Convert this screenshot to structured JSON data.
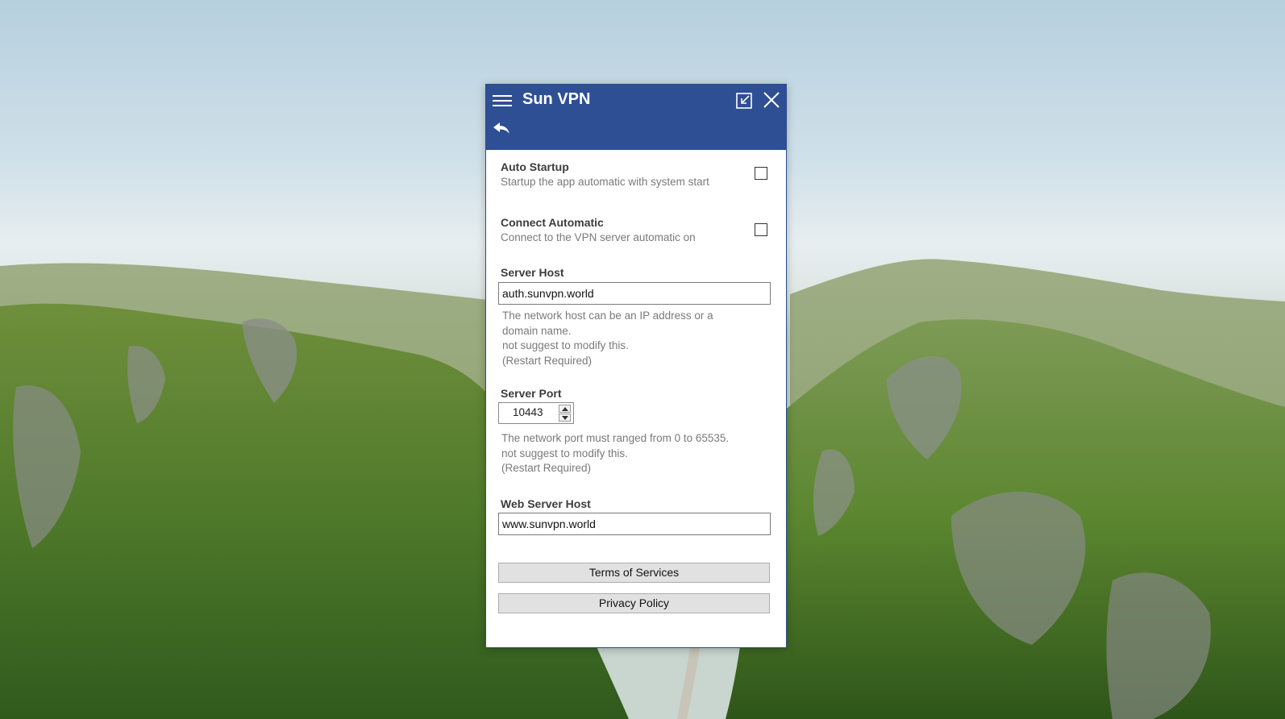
{
  "window": {
    "title": "Sun VPN",
    "accent_color": "#2e4f94",
    "icons": {
      "menu": "hamburger-menu-icon",
      "restore": "restore-down-icon",
      "close": "close-icon",
      "back": "back-arrow-icon"
    }
  },
  "settings": {
    "auto_startup": {
      "title": "Auto Startup",
      "description": "Startup the app automatic with system start",
      "checked": false
    },
    "connect_automatic": {
      "title": "Connect Automatic",
      "description": "Connect to the VPN server automatic on",
      "checked": false
    },
    "server_host": {
      "label": "Server Host",
      "value": "auth.sunvpn.world",
      "helper": [
        "The network host can be an IP address or a",
        "domain name.",
        "not suggest to modify this.",
        "(Restart Required)"
      ]
    },
    "server_port": {
      "label": "Server Port",
      "value": "10443",
      "helper": [
        "The network port must ranged from 0 to 65535.",
        "not suggest to modify this.",
        "(Restart Required)"
      ]
    },
    "web_server_host": {
      "label": "Web Server Host",
      "value": "www.sunvpn.world"
    }
  },
  "buttons": {
    "terms": "Terms of Services",
    "privacy": "Privacy Policy"
  }
}
